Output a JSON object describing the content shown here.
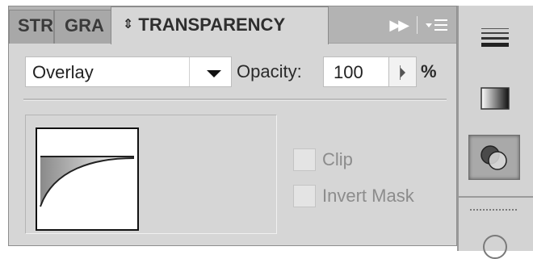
{
  "tabs": [
    {
      "label": "STR",
      "active": false
    },
    {
      "label": "GRA",
      "active": false
    },
    {
      "label": "TRANSPARENCY",
      "active": true
    }
  ],
  "tab_controls": {
    "collapse_icon": "double-chevron-right-icon",
    "menu_icon": "panel-menu-icon"
  },
  "blend_mode": {
    "value": "Overlay",
    "caret_icon": "caret-down-icon"
  },
  "opacity": {
    "label": "Opacity:",
    "value": "100",
    "unit": "%",
    "stepper_icon": "play-arrow-icon"
  },
  "mask": {
    "thumbnail_icon": "mask-thumbnail-icon"
  },
  "options": {
    "clip_label": "Clip",
    "clip_checked": false,
    "invert_mask_label": "Invert Mask",
    "invert_mask_checked": false
  },
  "dock": {
    "items": [
      {
        "name": "stroke",
        "icon": "stroke-lines-icon",
        "selected": false
      },
      {
        "name": "gradient",
        "icon": "gradient-square-icon",
        "selected": false
      },
      {
        "name": "transparency",
        "icon": "transparency-circles-icon",
        "selected": true
      }
    ]
  },
  "colors": {
    "panel_bg": "#d6d6d6",
    "tabbar_bg": "#b3b3b3",
    "disabled_text": "#8c8c8c"
  }
}
